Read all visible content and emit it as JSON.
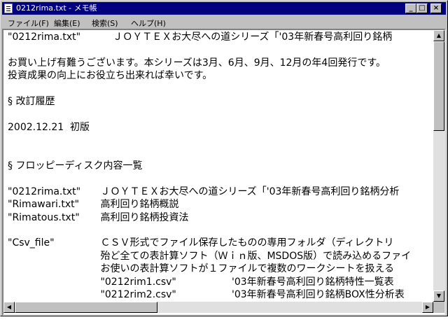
{
  "window": {
    "title": "0212rima.txt - メモ帳"
  },
  "menu": [
    {
      "label": "ファイル(F)"
    },
    {
      "label": "編集(E)"
    },
    {
      "label": "検索(S)"
    },
    {
      "label": "ヘルプ(H)"
    }
  ],
  "document": {
    "lines": [
      {
        "c1": "\"0212rima.txt\"",
        "c2": "     ＪＯＹＴＥＸお大尽への道シリーズ「'03年新春号高利回り銘柄"
      },
      {
        "c1": ""
      },
      {
        "c1": "お買い上げ有難うございます。本シリーズは3月、6月、9月、12月の年4回発行です。"
      },
      {
        "c1": "投資成果の向上にお役立ち出来れば幸いです。"
      },
      {
        "c1": ""
      },
      {
        "c1": "§ 改訂履歴"
      },
      {
        "c1": ""
      },
      {
        "c1": "2002.12.21  初版"
      },
      {
        "c1": ""
      },
      {
        "c1": ""
      },
      {
        "c1": "§ フロッピーディスク内容一覧"
      },
      {
        "c1": ""
      },
      {
        "c1": "\"0212rima.txt\"",
        "c2": " ＪＯＹＴＥＸお大尽への道シリーズ「'03年新春号高利回り銘柄分析"
      },
      {
        "c1": "\"Rimawari.txt\"",
        "c2": " 高利回り銘柄概説"
      },
      {
        "c1": "\"Rimatous.txt\"",
        "c2": " 高利回り銘柄投資法"
      },
      {
        "c1": ""
      },
      {
        "c1": "\"Csv_file\"",
        "c2": " ＣＳＶ形式でファイル保存したものの専用フォルダ（ディレクトリ"
      },
      {
        "c1": "",
        "c2": " 殆ど全ての表計算ソフト（Ｗｉｎ版、MSDOS版）で読み込めるファイ"
      },
      {
        "c1": "",
        "c2": " お使いの表計算ソフトが１ファイルで複数のワークシートを扱える"
      },
      {
        "c1": "",
        "c2": " \"0212rim1.csv\"",
        "c3": "'03年新春号高利回り銘柄特性一覧表"
      },
      {
        "c1": "",
        "c2": " \"0212rim2.csv\"",
        "c3": "'03年新春号高利回り銘柄BOX性分析表"
      }
    ]
  },
  "scroll": {
    "vertical_position": 0.0,
    "horizontal_position": 0.0
  }
}
